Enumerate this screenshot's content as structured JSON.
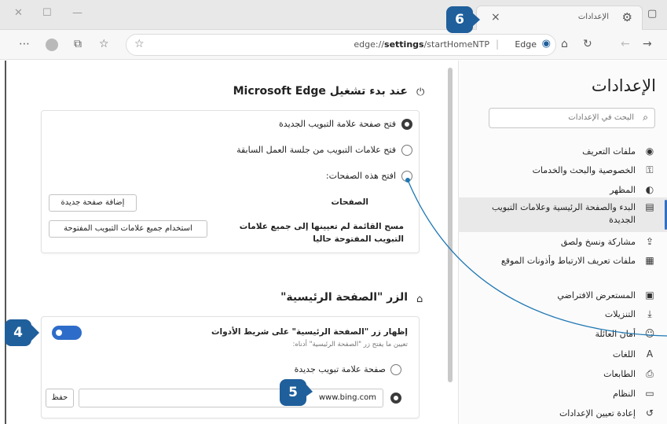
{
  "window": {
    "tab_title": "الإعدادات",
    "tab_close": "×",
    "minimize": "—",
    "maximize": "☐",
    "close": "✕"
  },
  "address": {
    "url_prefix": "edge://",
    "url_bold": "settings",
    "url_rest": "/startHomeNTP",
    "separator": "|",
    "edge_label": "Edge"
  },
  "sidebar": {
    "title": "الإعدادات",
    "search_placeholder": "البحث في الإعدادات",
    "items": [
      {
        "label": "ملفات التعريف",
        "icon": "profile-icon"
      },
      {
        "label": "الخصوصية والبحث والخدمات",
        "icon": "lock-icon"
      },
      {
        "label": "المظهر",
        "icon": "appearance-icon"
      },
      {
        "label": "البدء والصفحة الرئيسية وعلامات التبويب الجديدة",
        "icon": "start-home-icon"
      },
      {
        "label": "مشاركة ونسخ ولصق",
        "icon": "share-icon"
      },
      {
        "label": "ملفات تعريف الارتباط وأذونات الموقع",
        "icon": "cookies-icon"
      },
      {
        "label": "المستعرض الافتراضي",
        "icon": "default-browser-icon"
      },
      {
        "label": "التنزيلات",
        "icon": "download-icon"
      },
      {
        "label": "أمان العائلة",
        "icon": "family-icon"
      },
      {
        "label": "اللغات",
        "icon": "languages-icon"
      },
      {
        "label": "الطابعات",
        "icon": "printer-icon"
      },
      {
        "label": "النظام",
        "icon": "system-icon"
      },
      {
        "label": "إعادة تعيين الإعدادات",
        "icon": "reset-icon"
      }
    ],
    "active_index": 3
  },
  "startup": {
    "heading": "عند بدء تشغيل Microsoft Edge",
    "options": [
      "فتح صفحة علامة التبويب الجديدة",
      "فتح علامات التبويب من جلسة العمل السابقة",
      "افتح هذه الصفحات:"
    ],
    "selected_index": 0,
    "pages_label": "الصفحات",
    "add_page_button": "إضافة صفحة جديدة",
    "clear_text": "مسح القائمة لم تعيينها إلى جميع علامات التبويب المفتوحة حاليا",
    "use_open_tabs_button": "استخدام جميع علامات التبويب المفتوحة"
  },
  "home_button": {
    "heading": "الزر \"الصفحة الرئيسية\"",
    "show_label": "إظهار زر \"الصفحة الرئيسية\" على شريط الأدوات",
    "show_desc": "تعيين ما يفتح زر \"الصفحة الرئيسية\" أدناه:",
    "toggle_on": true,
    "option_new_tab": "صفحة علامة تبويب جديدة",
    "url_value": "www.bing.com",
    "save_button": "حفظ"
  },
  "callouts": {
    "four": "4",
    "five": "5",
    "six": "6"
  },
  "colors": {
    "callout": "#1f5f9b",
    "accent": "#2e6cc9",
    "connector": "#1f77b4"
  }
}
